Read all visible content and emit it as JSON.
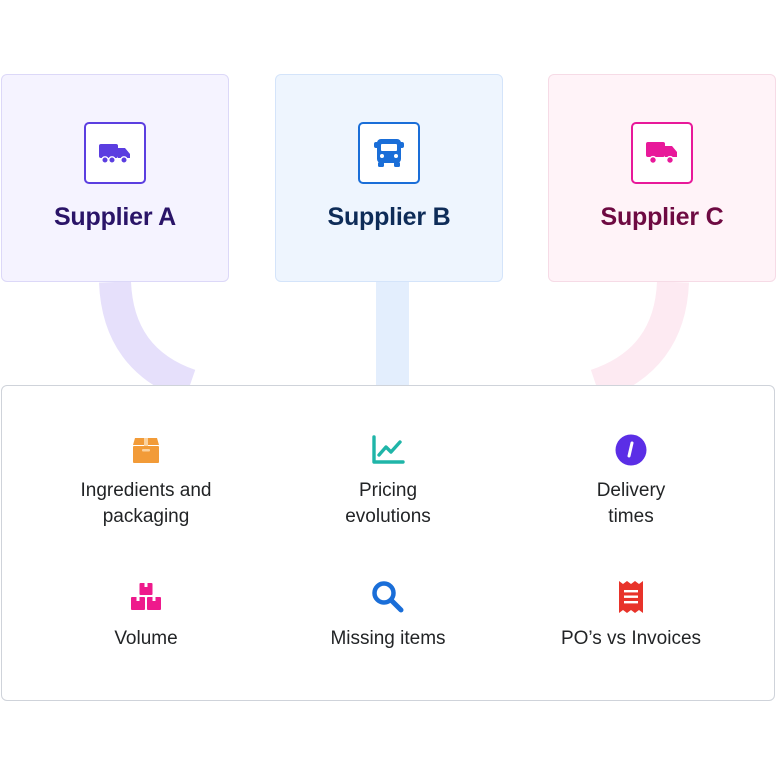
{
  "suppliers": [
    {
      "name": "Supplier A",
      "icon": "truck-icon",
      "color": "#5b3ee0"
    },
    {
      "name": "Supplier B",
      "icon": "bus-front-icon",
      "color": "#1a6ed8"
    },
    {
      "name": "Supplier C",
      "icon": "truck-icon",
      "color": "#e8199a"
    }
  ],
  "metrics": [
    {
      "label": "Ingredients and\npackaging",
      "icon": "box-icon",
      "color": "#f29b38"
    },
    {
      "label": "Pricing\nevolutions",
      "icon": "line-chart-icon",
      "color": "#1fb5a8"
    },
    {
      "label": "Delivery\ntimes",
      "icon": "clock-icon",
      "color": "#5b2ee6"
    },
    {
      "label": "Volume",
      "icon": "stacked-boxes-icon",
      "color": "#ee1a8c"
    },
    {
      "label": "Missing items",
      "icon": "search-icon",
      "color": "#1a6ed8"
    },
    {
      "label": "PO’s vs Invoices",
      "icon": "receipt-icon",
      "color": "#e8332a"
    }
  ]
}
